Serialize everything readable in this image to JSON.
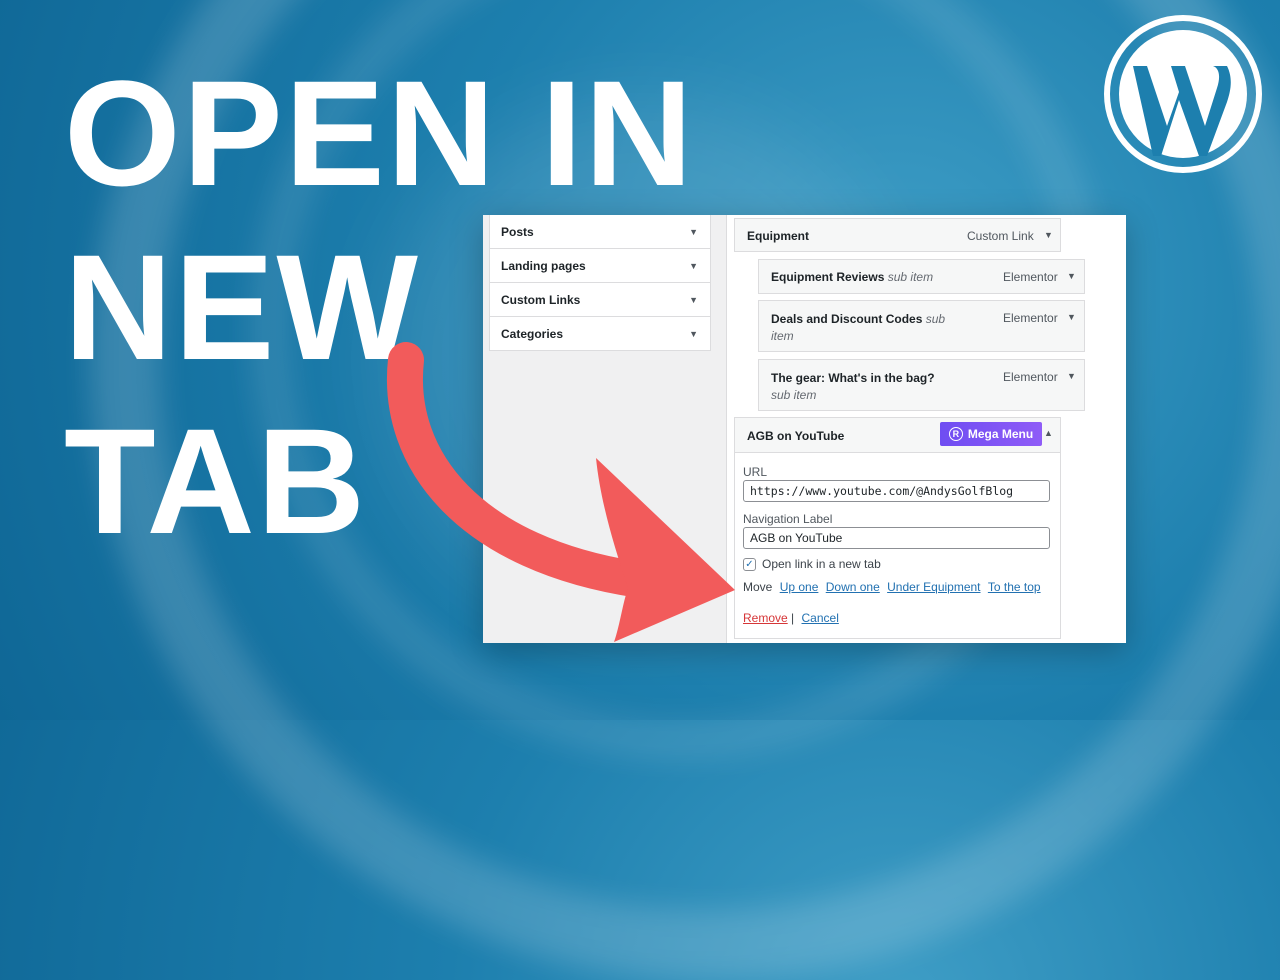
{
  "headline": {
    "line1": "OPEN IN",
    "line2": "NEW",
    "line3": "TAB"
  },
  "colors": {
    "background": "#1d7fae",
    "arrow": "#f25b5b",
    "accent_link": "#2271b1",
    "mega_menu": "#7a52f4",
    "remove_link": "#d63638"
  },
  "logo": "wordpress-logo",
  "left_panel": {
    "accordion": [
      {
        "label": "Posts"
      },
      {
        "label": "Landing pages"
      },
      {
        "label": "Custom Links"
      },
      {
        "label": "Categories"
      }
    ]
  },
  "menu_items": {
    "equipment": {
      "title": "Equipment",
      "type": "Custom Link"
    },
    "reviews": {
      "title": "Equipment Reviews",
      "sub": "sub item",
      "type": "Elementor"
    },
    "deals": {
      "title": "Deals and Discount Codes",
      "sub": "sub item",
      "type": "Elementor"
    },
    "gear": {
      "title": "The gear: What's in the bag?",
      "sub": "sub item",
      "type": "Elementor"
    },
    "agb": {
      "title": "AGB on YouTube",
      "mega_menu_label": "Mega Menu",
      "mega_menu_icon_letter": "R",
      "url_label": "URL",
      "url_value": "https://www.youtube.com/@AndysGolfBlog",
      "nav_label": "Navigation Label",
      "nav_value": "AGB on YouTube",
      "new_tab_label": "Open link in a new tab",
      "new_tab_checked": true,
      "move_label": "Move",
      "move_links": [
        "Up one",
        "Down one",
        "Under Equipment",
        "To the top"
      ],
      "remove_label": "Remove",
      "separator": "|",
      "cancel_label": "Cancel"
    }
  }
}
